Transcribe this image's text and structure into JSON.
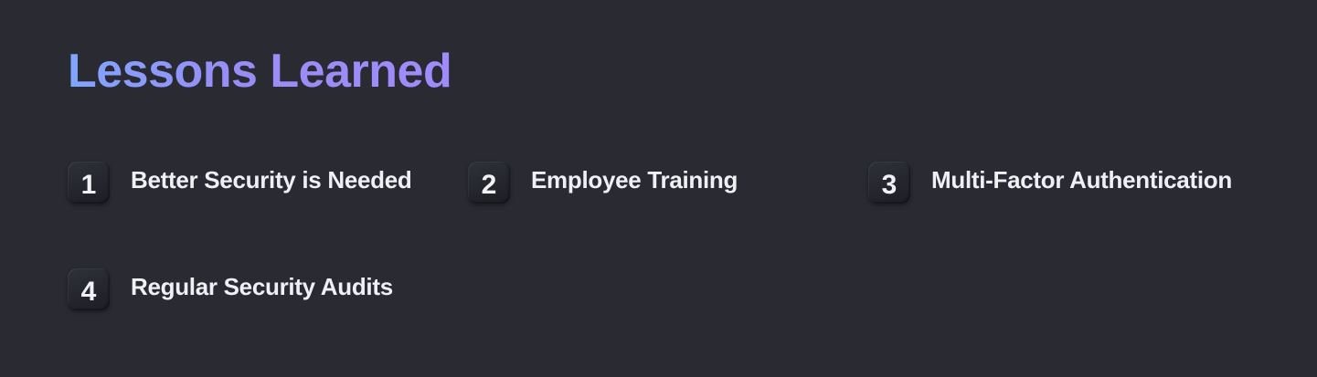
{
  "slide": {
    "title": "Lessons Learned",
    "title_gradient": [
      "#7fa6ff",
      "#a08bfa"
    ],
    "background": "#292a32",
    "lessons": [
      {
        "number": "1",
        "text": "Better Security is Needed"
      },
      {
        "number": "2",
        "text": "Employee Training"
      },
      {
        "number": "3",
        "text": "Multi-Factor Authentication"
      },
      {
        "number": "4",
        "text": "Regular Security Audits"
      }
    ]
  }
}
